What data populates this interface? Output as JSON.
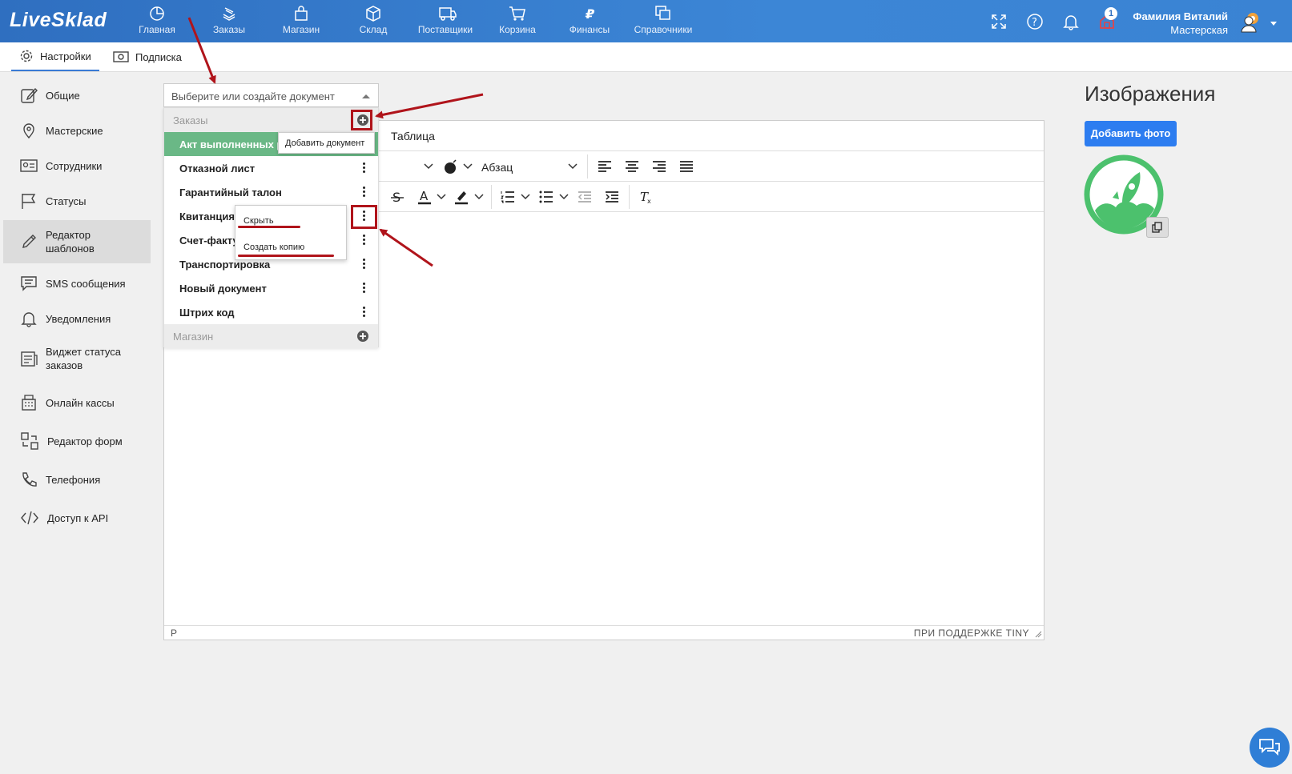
{
  "app": {
    "logo": "LiveSklad"
  },
  "nav": [
    {
      "label": "Главная",
      "icon": "pie-chart-icon"
    },
    {
      "label": "Заказы",
      "icon": "stack-icon"
    },
    {
      "label": "Магазин",
      "icon": "bag-icon"
    },
    {
      "label": "Склад",
      "icon": "box-icon"
    },
    {
      "label": "Поставщики",
      "icon": "truck-icon"
    },
    {
      "label": "Корзина",
      "icon": "cart-icon"
    },
    {
      "label": "Финансы",
      "icon": "ruble-icon"
    },
    {
      "label": "Справочники",
      "icon": "copy-icon"
    }
  ],
  "header": {
    "notification_count": "1",
    "user_name": "Фамилия Виталий",
    "user_location": "Мастерская"
  },
  "subtabs": [
    {
      "label": "Настройки",
      "icon": "gear-icon"
    },
    {
      "label": "Подписка",
      "icon": "money-icon"
    }
  ],
  "sidebar": [
    {
      "label": "Общие",
      "icon": "edit-icon"
    },
    {
      "label": "Мастерские",
      "icon": "location-icon"
    },
    {
      "label": "Сотрудники",
      "icon": "id-card-icon"
    },
    {
      "label": "Статусы",
      "icon": "flag-icon"
    },
    {
      "label": "Редактор шаблонов",
      "label_line1": "Редактор",
      "label_line2": "шаблонов",
      "icon": "pencil-icon",
      "active": true
    },
    {
      "label": "SMS сообщения",
      "icon": "message-icon"
    },
    {
      "label": "Уведомления",
      "icon": "bell-icon"
    },
    {
      "label": "Виджет статуса заказов",
      "label_line1": "Виджет статуса",
      "label_line2": "заказов",
      "icon": "widget-icon"
    },
    {
      "label": "Онлайн кассы",
      "icon": "cash-register-icon"
    },
    {
      "label": "Редактор форм",
      "icon": "form-icon"
    },
    {
      "label": "Телефония",
      "icon": "phone-icon"
    },
    {
      "label": "Доступ к API",
      "icon": "code-icon"
    }
  ],
  "doc_select": {
    "placeholder": "Выберите или создайте документ"
  },
  "dropdown": {
    "groups": [
      {
        "name": "Заказы",
        "items": [
          "Акт выполненных работ",
          "Отказной лист",
          "Гарантийный талон",
          "Квитанция",
          "Счет-фактура",
          "Транспортировка",
          "Новый документ",
          "Штрих код"
        ],
        "active_item_visible": "Акт выполненных р"
      },
      {
        "name": "Магазин",
        "items": []
      }
    ],
    "add_tooltip": "Добавить документ",
    "context_menu": [
      "Скрыть",
      "Создать копию"
    ],
    "visible_labels": [
      "Акт выполненных р",
      "Отказной лист",
      "Гарантийный талон",
      "Квитанция",
      "Счет-факту",
      "Транспортировка",
      "Новый документ",
      "Штрих код"
    ]
  },
  "editor": {
    "menu_table": "Таблица",
    "block_format": "Абзац",
    "status_path": "P",
    "powered_by": "ПРИ ПОДДЕРЖКЕ TINY"
  },
  "images": {
    "title": "Изображения",
    "add_button": "Добавить фото"
  },
  "colors": {
    "topbar": "#3a83d3",
    "accent": "#2d7df0",
    "active_item": "#6ab886",
    "annotation": "#b0141b",
    "logo_green": "#4cc16d"
  }
}
